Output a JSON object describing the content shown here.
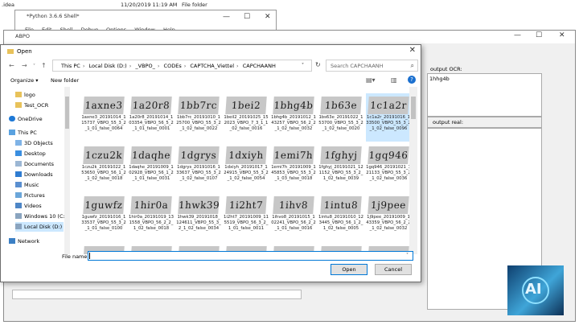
{
  "background_explorer": {
    "folder_name": ".idea",
    "date": "11/20/2019 11:19 AM",
    "type": "File folder"
  },
  "shell": {
    "title": "*Python 3.6.6 Shell*",
    "menu": [
      "File",
      "Edit",
      "Shell",
      "Debug",
      "Options",
      "Window",
      "Help"
    ]
  },
  "app": {
    "title": "ABPO",
    "output_ocr_label": "output OCR:",
    "output_ocr_value": "1hhg4b",
    "output_real_label": "output real:"
  },
  "open_dialog": {
    "title": "Open",
    "breadcrumb": [
      "This PC",
      "Local Disk (D:)",
      "_VBPO_",
      "CODEs",
      "CAPTCHA_Viettel",
      "CAPCHAANH"
    ],
    "search_placeholder": "Search CAPCHAANH",
    "organize_label": "Organize",
    "new_folder_label": "New folder",
    "nav_items": [
      "logo",
      "Test_OCR",
      "OneDrive",
      "This PC",
      "3D Objects",
      "Desktop",
      "Documents",
      "Downloads",
      "Music",
      "Pictures",
      "Videos",
      "Windows 10 (C:)",
      "Local Disk (D:)",
      "Network"
    ],
    "files": [
      {
        "captcha": "1axne3",
        "name": "1axne3_20191014_115737_VBPO_55_3_2_1_01_false_0064"
      },
      {
        "captcha": "1a20r8",
        "name": "1a20r8_20191014_103354_VBPO_56_5_2_1_01_false_0001"
      },
      {
        "captcha": "1bb7rc",
        "name": "1bb7rc_20191010_125700_VBPO_55_3_2_1_02_false_0022"
      },
      {
        "captcha": "1bei2",
        "name": "1beil2_20191025_152023_VBPO_7_3_1_1_02_false_0016"
      },
      {
        "captcha": "1bhg4b",
        "name": "1bhg4b_20191012_143257_VBPO_56_2_2_1_02_false_0032"
      },
      {
        "captcha": "1b63e",
        "name": "1bs63e_20191022_153700_VBPO_55_3_2_1_02_false_0020"
      },
      {
        "captcha": "1c1a2r",
        "name": "1c1a2r_20191016_133500_VBPO_55_3_2_1_02_false_0096"
      },
      {
        "captcha": "1czu2k",
        "name": "1czu2k_20191022_153650_VBPO_56_1_2_1_02_false_0018"
      },
      {
        "captcha": "1daqhe",
        "name": "1daqhe_20191009_102928_VBPO_56_1_2_1_01_false_0031"
      },
      {
        "captcha": "1dgrys",
        "name": "1dgrys_20191016_133637_VBPO_55_3_2_1_02_false_0107"
      },
      {
        "captcha": "1dxiyh",
        "name": "1dxiyh_20191017_124915_VBPO_55_3_2_1_02_false_0054"
      },
      {
        "captcha": "1emi7h",
        "name": "1emi7h_20191009_145853_VBPO_55_3_2_1_03_false_0018"
      },
      {
        "captcha": "1fghyj",
        "name": "1fghyj_20191021_121152_VBPO_55_3_2_1_02_false_0039"
      },
      {
        "captcha": "1gq946",
        "name": "1gq946_20191021_121133_VBPO_55_3_2_1_02_false_0036"
      },
      {
        "captcha": "1guwfz",
        "name": "1guwfz_20191016_133537_VBPO_55_3_2_1_01_false_0100"
      },
      {
        "captcha": "1hir0a",
        "name": "1hir0a_20191019_131558_VBPO_56_2_2_1_02_false_0018"
      },
      {
        "captcha": "1hwk39",
        "name": "1hwk39_20191018_124611_VBPO_55_3_2_1_02_false_0034"
      },
      {
        "captcha": "1i2ht7",
        "name": "1i2ht7_20191009_115519_VBPO_56_3_2_1_01_false_0011"
      },
      {
        "captcha": "1ihv8",
        "name": "1ihvo8_20191015_102241_VBPO_56_2_2_1_01_false_0016"
      },
      {
        "captcha": "1intu8",
        "name": "1intu8_20191010_123445_VBPO_56_1_2_1_02_false_0005"
      },
      {
        "captcha": "1j9pee",
        "name": "1j9pee_20191009_143359_VBPO_56_2_2_1_02_false_0032"
      }
    ],
    "file_name_label": "File name:",
    "file_name_value": "",
    "open_label": "Open",
    "cancel_label": "Cancel"
  },
  "colors": {
    "selection": "#cce8ff",
    "accent": "#0078d7"
  }
}
